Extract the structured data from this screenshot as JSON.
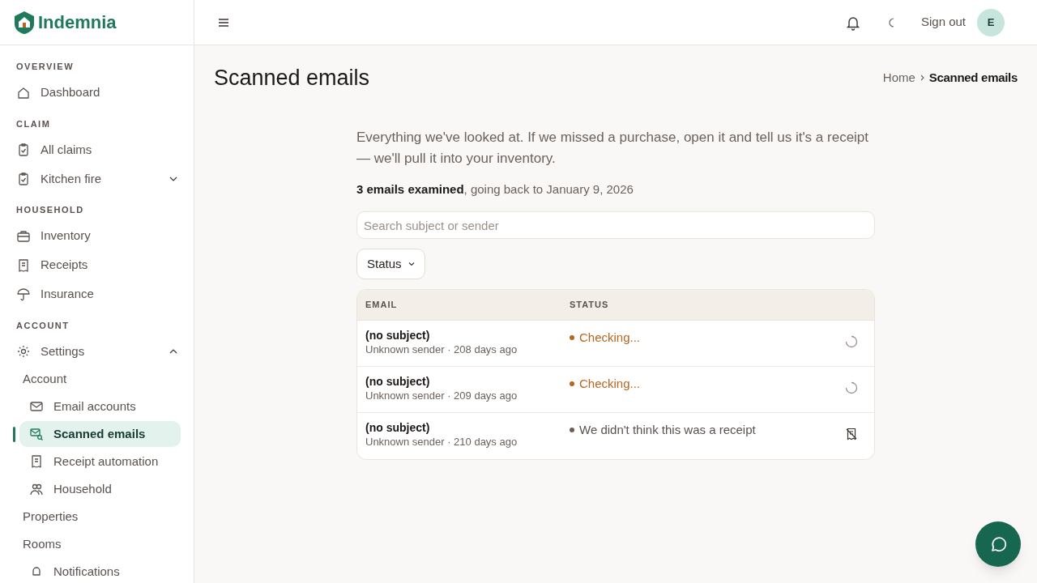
{
  "brand": "Indemnia",
  "sidebar": {
    "sections": [
      {
        "title": "OVERVIEW",
        "items": [
          {
            "label": "Dashboard",
            "selected": false
          }
        ]
      },
      {
        "title": "CLAIM",
        "items": [
          {
            "label": "All claims",
            "selected": false
          },
          {
            "label": "Kitchen fire",
            "selected": false,
            "expanded": false
          }
        ]
      },
      {
        "title": "HOUSEHOLD",
        "items": [
          {
            "label": "Inventory",
            "selected": false
          },
          {
            "label": "Receipts",
            "selected": false
          },
          {
            "label": "Insurance",
            "selected": false
          }
        ]
      },
      {
        "title": "ACCOUNT",
        "items": [
          {
            "label": "Settings",
            "selected": false,
            "expanded": true,
            "children": [
              {
                "label": "Account",
                "selected": false
              },
              {
                "label": "Email accounts",
                "selected": false
              },
              {
                "label": "Scanned emails",
                "selected": true
              },
              {
                "label": "Receipt automation",
                "selected": false
              },
              {
                "label": "Household",
                "selected": false
              },
              {
                "label": "Properties",
                "selected": false
              },
              {
                "label": "Rooms",
                "selected": false
              },
              {
                "label": "Notifications",
                "selected": false
              }
            ]
          }
        ]
      }
    ]
  },
  "topbar": {
    "sign_out": "Sign out",
    "avatar": "E"
  },
  "page": {
    "title": "Scanned emails",
    "breadcrumb": [
      "Home",
      "Scanned emails"
    ],
    "intro": "Everything we've looked at. If we missed a purchase, open it and tell us it's a receipt — we'll pull it into your inventory.",
    "summary": "**3 emails examined**, going back to January 9, 2026",
    "search": {
      "placeholder": "Search subject or sender"
    },
    "filter": "Status",
    "table": {
      "columns": [
        "EMAIL",
        "STATUS"
      ],
      "rows": [
        {
          "subject": "(no subject)",
          "meta": "Unknown sender · 208 days ago",
          "status": {
            "kind": "checking",
            "label": "Checking...",
            "color": "#b8661e"
          }
        },
        {
          "subject": "(no subject)",
          "meta": "Unknown sender · 209 days ago",
          "status": {
            "kind": "checking",
            "label": "Checking...",
            "color": "#b8661e"
          }
        },
        {
          "subject": "(no subject)",
          "meta": "Unknown sender · 210 days ago",
          "status": {
            "kind": "rejected",
            "label": "We didn't think this was a receipt",
            "color": "#6b5f58"
          }
        }
      ]
    }
  }
}
